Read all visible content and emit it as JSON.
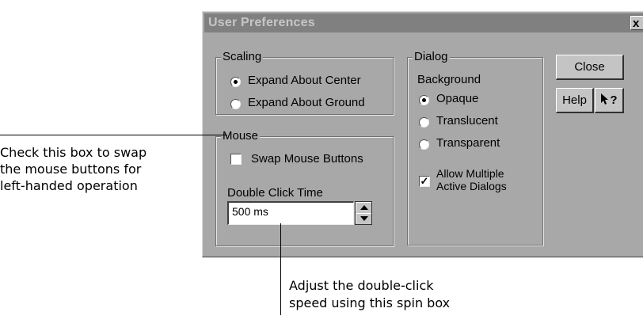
{
  "dialog": {
    "title": "User Preferences",
    "close_x": "x"
  },
  "scaling": {
    "legend": "Scaling",
    "options": [
      {
        "label": "Expand About Center",
        "selected": true
      },
      {
        "label": "Expand About Ground",
        "selected": false
      }
    ]
  },
  "mouse": {
    "legend": "Mouse",
    "swap_label": "Swap Mouse Buttons",
    "swap_checked": false,
    "dbl_click_label": "Double Click Time",
    "dbl_click_value": "500 ms"
  },
  "dialog_group": {
    "legend": "Dialog",
    "background_label": "Background",
    "options": [
      {
        "label": "Opaque",
        "selected": true
      },
      {
        "label": "Translucent",
        "selected": false
      },
      {
        "label": "Transparent",
        "selected": false
      }
    ],
    "allow_multiple_line1": "Allow Multiple",
    "allow_multiple_line2": "Active Dialogs",
    "allow_multiple_checked": true
  },
  "buttons": {
    "close": "Close",
    "help": "Help",
    "whatsthis": "?"
  },
  "annotations": {
    "left_line1": "Check this box to swap",
    "left_line2": "the mouse buttons for",
    "left_line3": "left-handed operation",
    "bottom_line1": "Adjust the double-click",
    "bottom_line2": "speed using this spin box"
  },
  "icons": {
    "whatsthis_arrow": "arrow-pointer-icon",
    "spin_up": "triangle-up-icon",
    "spin_down": "triangle-down-icon"
  }
}
